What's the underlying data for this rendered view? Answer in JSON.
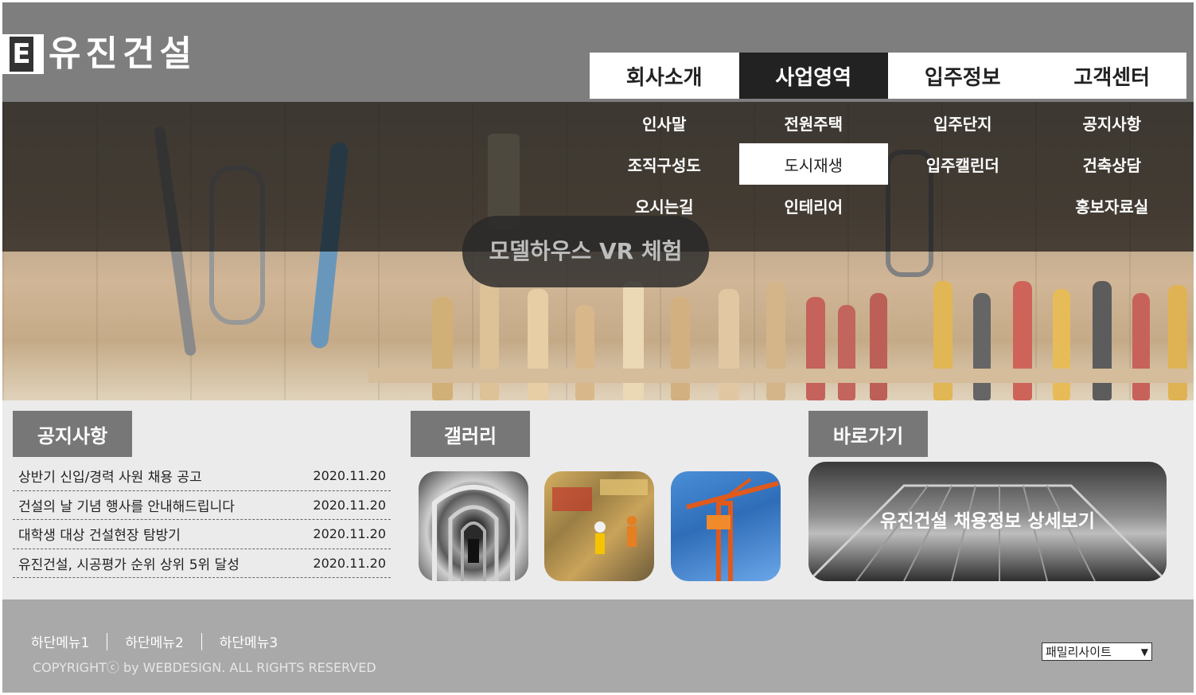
{
  "header": {
    "logo_mark": "E",
    "logo_text": "유진건설",
    "nav": [
      {
        "label": "회사소개"
      },
      {
        "label": "사업영역"
      },
      {
        "label": "입주정보"
      },
      {
        "label": "고객센터"
      }
    ],
    "active_nav": "사업영역"
  },
  "submenu": [
    [
      "인사말",
      "조직구성도",
      "오시는길"
    ],
    [
      "전원주택",
      "도시재생",
      "인테리어"
    ],
    [
      "입주단지",
      "입주캘린더"
    ],
    [
      "공지사항",
      "건축상담",
      "홍보자료실"
    ]
  ],
  "hero": {
    "overlay_text": "모델하우스 VR 체험"
  },
  "sections": {
    "notice_title": "공지사항",
    "gallery_title": "갤러리",
    "shortcut_title": "바로가기"
  },
  "notices": [
    {
      "title": "상반기 신입/경력 사원 채용 공고",
      "date": "2020.11.20"
    },
    {
      "title": "건설의 날 기념 행사를 안내해드립니다",
      "date": "2020.11.20"
    },
    {
      "title": "대학생 대상 건설현장 탐방기",
      "date": "2020.11.20"
    },
    {
      "title": "유진건설, 시공평가 순위 상위 5위 달성",
      "date": "2020.11.20"
    }
  ],
  "gallery": [
    {
      "icon": "cloister-photo"
    },
    {
      "icon": "construction-workers-photo"
    },
    {
      "icon": "crane-photo"
    }
  ],
  "shortcut": {
    "label": "유진건설 채용정보 상세보기"
  },
  "footer": {
    "menu": [
      "하단메뉴1",
      "하단메뉴2",
      "하단메뉴3"
    ],
    "copyright": "COPYRIGHTⓒ by WEBDESIGN. ALL RIGHTS RESERVED",
    "family_site": "패밀리사이트"
  },
  "colors": {
    "header_bg": "#7e7e7e",
    "nav_active_bg": "#222222",
    "section_tab_bg": "#777777",
    "footer_bg": "#a9a9a9"
  }
}
